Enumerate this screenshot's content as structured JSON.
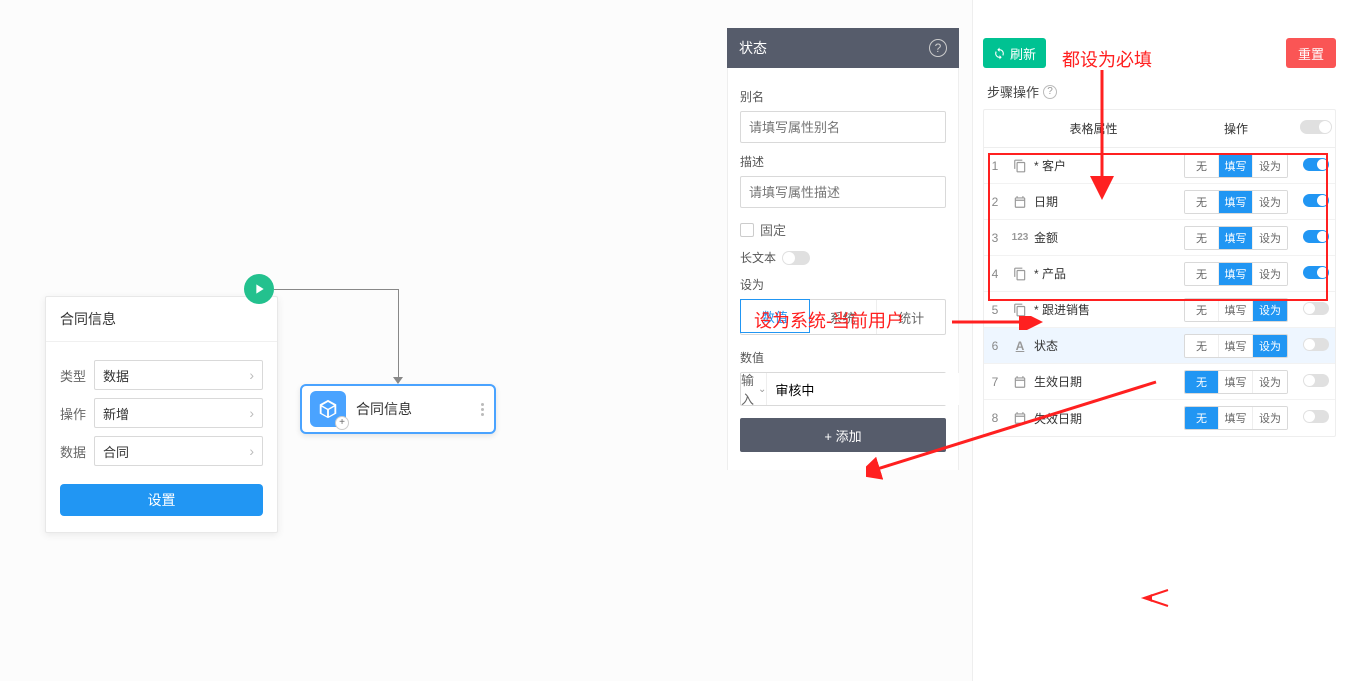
{
  "configCard": {
    "title": "合同信息",
    "rows": {
      "type_label": "类型",
      "type_value": "数据",
      "op_label": "操作",
      "op_value": "新增",
      "data_label": "数据",
      "data_value": "合同"
    },
    "button": "设置"
  },
  "flowNode": {
    "title": "合同信息"
  },
  "midPanel": {
    "header": "状态",
    "alias_label": "别名",
    "alias_placeholder": "请填写属性别名",
    "desc_label": "描述",
    "desc_placeholder": "请填写属性描述",
    "fixed_label": "固定",
    "longtext_label": "长文本",
    "setas_label": "设为",
    "tabs": {
      "value": "数值",
      "system": "系统",
      "stat": "统计"
    },
    "value_label": "数值",
    "mode_label": "输入",
    "value_input": "审核中",
    "add_button": "+  添加"
  },
  "rightPanel": {
    "refresh": "刷新",
    "reset": "重置",
    "section": "步骤操作",
    "colAttr": "表格属性",
    "colOps": "操作",
    "opNone": "无",
    "opFill": "填写",
    "opSet": "设为",
    "rows": [
      {
        "num": "1",
        "icon": "copy",
        "label": "* 客户",
        "active": "fill",
        "switch": "on"
      },
      {
        "num": "2",
        "icon": "date",
        "label": "日期",
        "active": "fill",
        "switch": "on"
      },
      {
        "num": "3",
        "icon": "num",
        "label": "金额",
        "active": "fill",
        "switch": "on"
      },
      {
        "num": "4",
        "icon": "copy",
        "label": "* 产品",
        "active": "fill",
        "switch": "on"
      },
      {
        "num": "5",
        "icon": "copy",
        "label": "* 跟进销售",
        "active": "set",
        "switch": "off"
      },
      {
        "num": "6",
        "icon": "text",
        "label": "状态",
        "active": "set",
        "switch": "off",
        "selected": true
      },
      {
        "num": "7",
        "icon": "date",
        "label": "生效日期",
        "active": "none",
        "switch": "off"
      },
      {
        "num": "8",
        "icon": "date",
        "label": "失效日期",
        "active": "none",
        "switch": "off"
      }
    ]
  },
  "annotations": {
    "a1": "都设为必填",
    "a2": "设为系统-当前用户"
  }
}
